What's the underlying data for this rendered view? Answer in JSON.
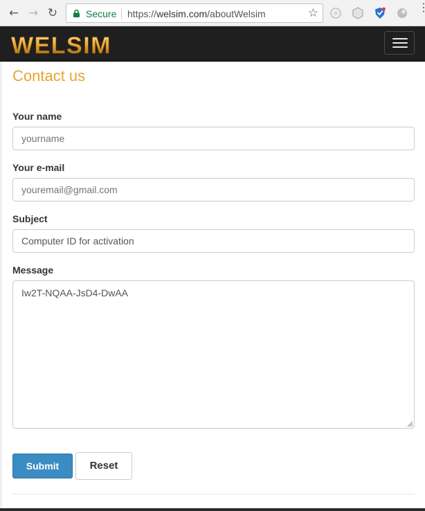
{
  "browser": {
    "secure_label": "Secure",
    "url_scheme": "https://",
    "url_host": "welsim.com",
    "url_path": "/aboutWelsim",
    "back_icon": "arrow-left",
    "forward_icon": "arrow-right",
    "reload_icon": "reload",
    "bookmark_icon": "star-outline"
  },
  "site": {
    "logo_text": "WELSIM",
    "logo_color": "#e8a530",
    "navbar_color": "#1f1f1f"
  },
  "page": {
    "title": "Contact us",
    "title_color": "#e8a530"
  },
  "form": {
    "name": {
      "label": "Your name",
      "placeholder": "yourname",
      "value": ""
    },
    "email": {
      "label": "Your e-mail",
      "placeholder": "youremail@gmail.com",
      "value": ""
    },
    "subject": {
      "label": "Subject",
      "placeholder": "",
      "value": "Computer ID for activation"
    },
    "message": {
      "label": "Message",
      "value": "Iw2T-NQAA-JsD4-DwAA"
    },
    "submit_label": "Submit",
    "reset_label": "Reset",
    "submit_color": "#3a8cc3"
  }
}
